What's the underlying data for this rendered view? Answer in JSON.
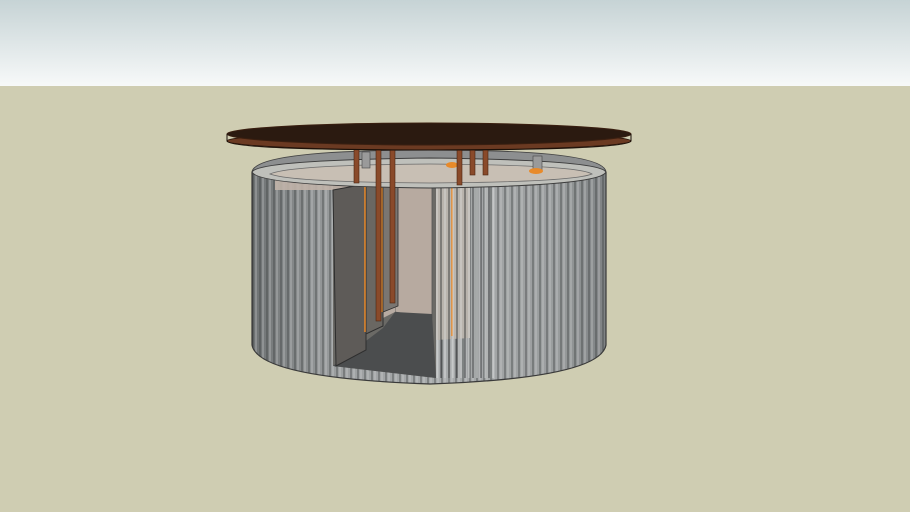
{
  "scene": {
    "sky_top_color": "#c6d3d5",
    "sky_bottom_color": "#f7f9f9",
    "ground_color": "#cfcdb2",
    "roof_color": "#2b1a10",
    "roof_rim_color": "#6b3a22",
    "post_color": "#8a4a2a",
    "wall_color": "#8f9293",
    "interior_floor_color": "#4b4d4e",
    "door_color": "#5e5b58",
    "accent_color": "#e88a2a"
  }
}
